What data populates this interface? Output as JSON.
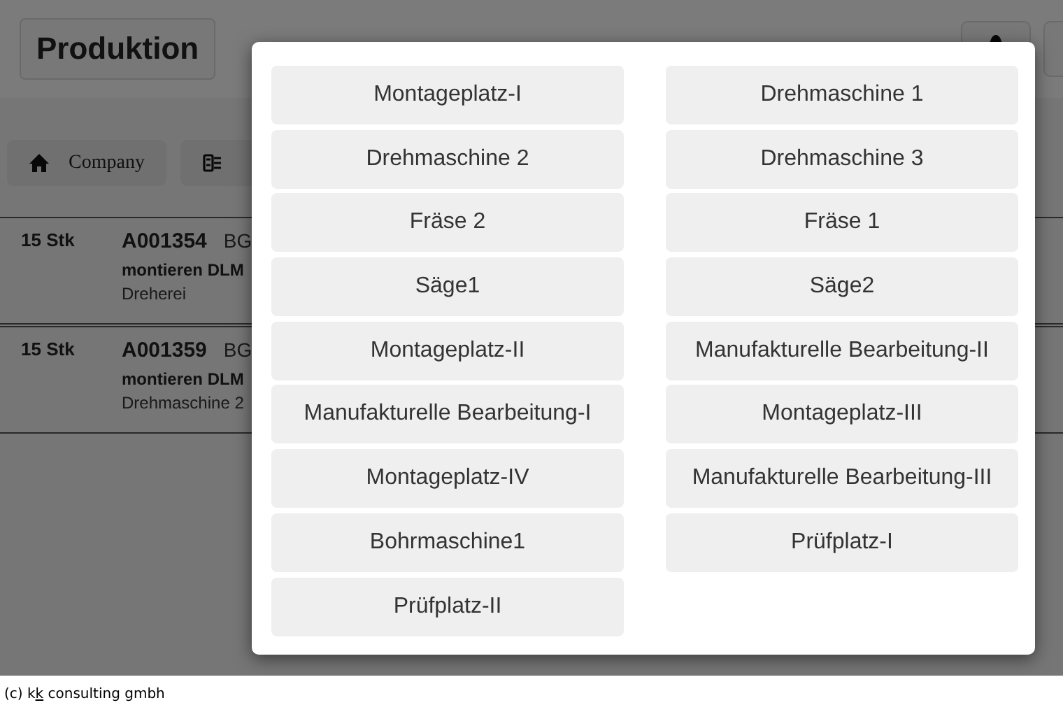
{
  "header": {
    "title": "Produktion"
  },
  "nav": [
    {
      "label": "Company",
      "kind": "home"
    },
    {
      "kind": "list"
    }
  ],
  "rows": [
    {
      "quantity": "15 Stk",
      "order": "A001354",
      "type": "BG",
      "task": "montieren DLM",
      "location": "Dreherei"
    },
    {
      "quantity": "15 Stk",
      "order": "A001359",
      "type": "BG",
      "task": "montieren DLM",
      "location": "Drehmaschine 2"
    }
  ],
  "dialog": {
    "options": [
      {
        "label": "Montageplatz-I"
      },
      {
        "label": "Drehmaschine 1"
      },
      {
        "label": "Drehmaschine 2"
      },
      {
        "label": "Drehmaschine 3"
      },
      {
        "label": "Fräse 2"
      },
      {
        "label": "Fräse 1"
      },
      {
        "label": "Säge1"
      },
      {
        "label": "Säge2"
      },
      {
        "label": "Montageplatz-II"
      },
      {
        "label": "Manufakturelle Bearbeitung-II"
      },
      {
        "label": "Manufakturelle Bearbeitung-I"
      },
      {
        "label": "Montageplatz-III"
      },
      {
        "label": "Montageplatz-IV"
      },
      {
        "label": "Manufakturelle Bearbeitung-III"
      },
      {
        "label": "Bohrmaschine1"
      },
      {
        "label": "Prüfplatz-I"
      },
      {
        "label": "Prüfplatz-II"
      }
    ]
  },
  "footer": {
    "prefix": "(c) k",
    "underlined": "k",
    "suffix": " consulting gmbh"
  }
}
